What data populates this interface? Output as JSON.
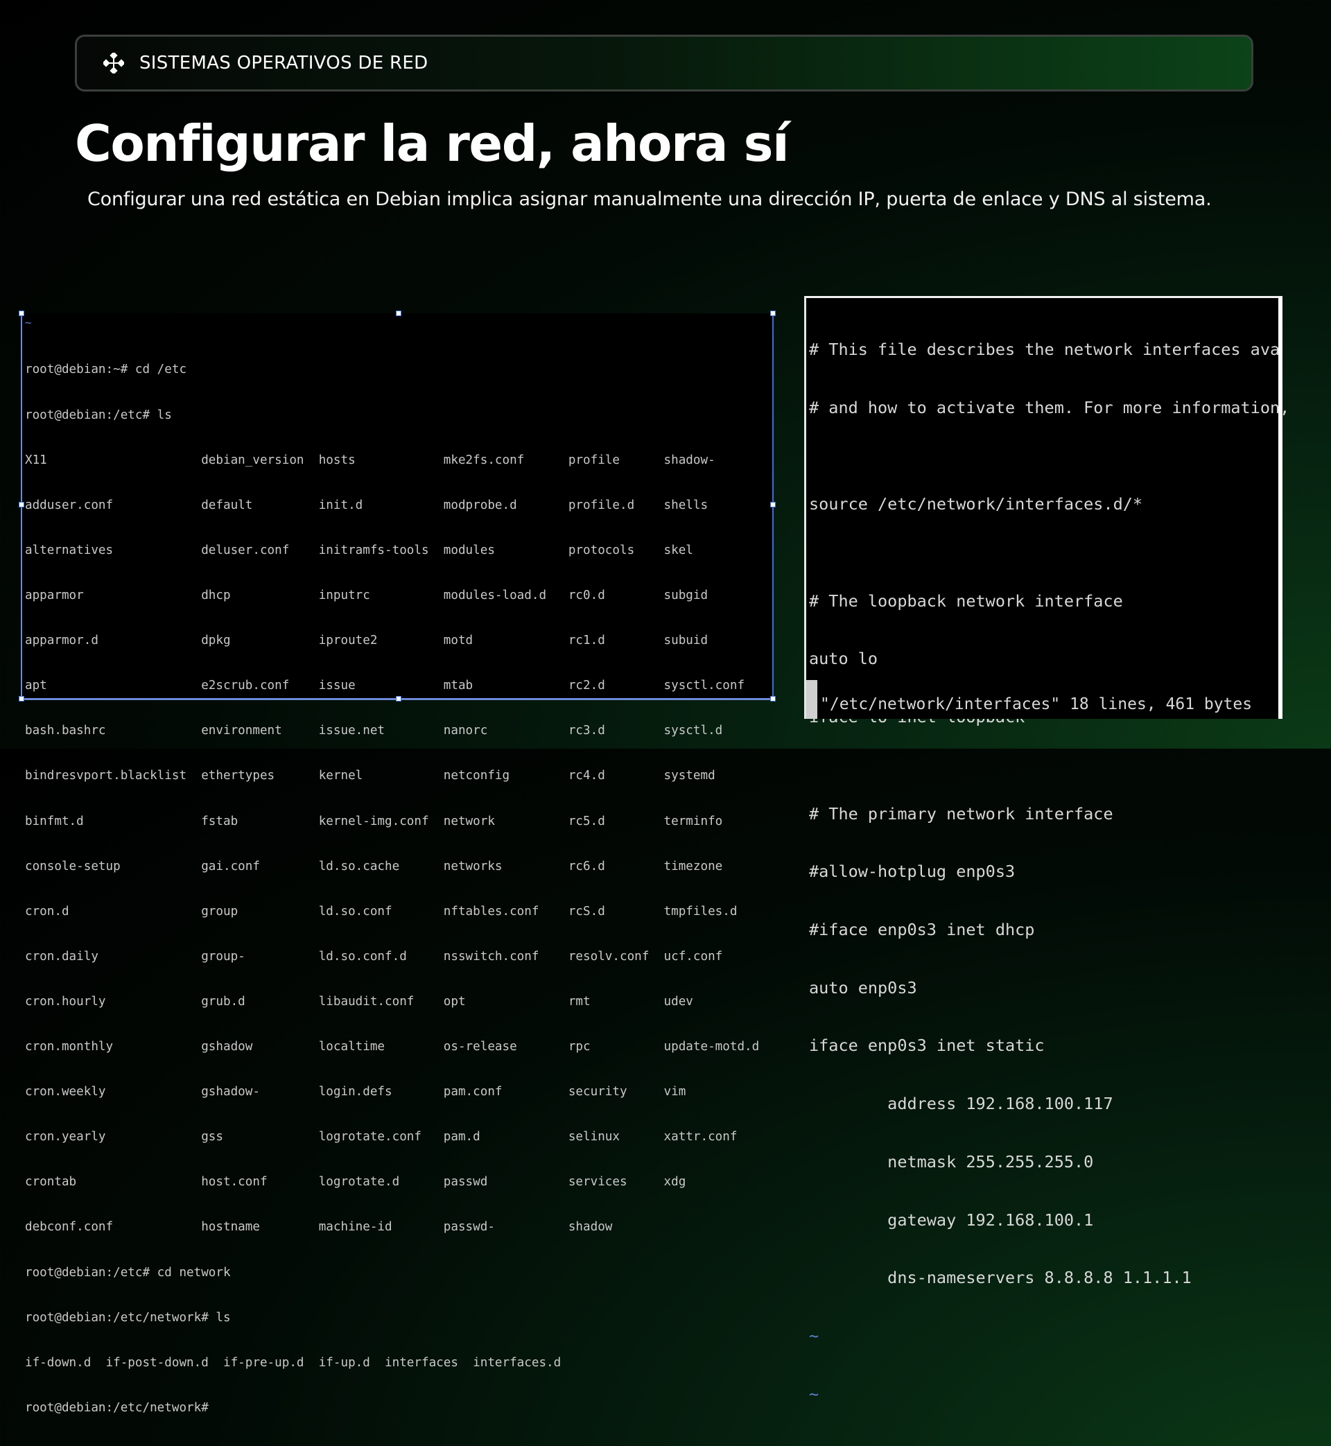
{
  "header": {
    "label": "SISTEMAS OPERATIVOS DE RED",
    "icon": "network-nodes-icon"
  },
  "title": "Configurar la red, ahora sí",
  "subtitle": "Configurar una red estática en Debian implica asignar manualmente una dirección IP, puerta de enlace y DNS al sistema.",
  "colors": {
    "background": "#000000",
    "accent_green": "#0c4318",
    "selection_blue": "#3b6fd6",
    "vim_tilde_blue": "#5f7fd8"
  },
  "terminal_left": {
    "tilde": "~",
    "lines": [
      "root@debian:~# cd /etc",
      "root@debian:/etc# ls",
      "X11                     debian_version  hosts            mke2fs.conf      profile      shadow-",
      "adduser.conf            default         init.d           modprobe.d       profile.d    shells",
      "alternatives            deluser.conf    initramfs-tools  modules          protocols    skel",
      "apparmor                dhcp            inputrc          modules-load.d   rc0.d        subgid",
      "apparmor.d              dpkg            iproute2         motd             rc1.d        subuid",
      "apt                     e2scrub.conf    issue            mtab             rc2.d        sysctl.conf",
      "bash.bashrc             environment     issue.net        nanorc           rc3.d        sysctl.d",
      "bindresvport.blacklist  ethertypes      kernel           netconfig        rc4.d        systemd",
      "binfmt.d                fstab           kernel-img.conf  network          rc5.d        terminfo",
      "console-setup           gai.conf        ld.so.cache      networks         rc6.d        timezone",
      "cron.d                  group           ld.so.conf       nftables.conf    rcS.d        tmpfiles.d",
      "cron.daily              group-          ld.so.conf.d     nsswitch.conf    resolv.conf  ucf.conf",
      "cron.hourly             grub.d          libaudit.conf    opt              rmt          udev",
      "cron.monthly            gshadow         localtime        os-release       rpc          update-motd.d",
      "cron.weekly             gshadow-        login.defs       pam.conf         security     vim",
      "cron.yearly             gss             logrotate.conf   pam.d            selinux      xattr.conf",
      "crontab                 host.conf       logrotate.d      passwd           services     xdg",
      "debconf.conf            hostname        machine-id       passwd-          shadow",
      "root@debian:/etc# cd network",
      "root@debian:/etc/network# ls",
      "if-down.d  if-post-down.d  if-pre-up.d  if-up.d  interfaces  interfaces.d",
      "root@debian:/etc/network#"
    ]
  },
  "terminal_right": {
    "file_lines": [
      "# This file describes the network interfaces ava",
      "# and how to activate them. For more information,",
      "",
      "source /etc/network/interfaces.d/*",
      "",
      "# The loopback network interface",
      "auto lo",
      "iface lo inet loopback",
      "",
      "# The primary network interface",
      "#allow-hotplug enp0s3",
      "#iface enp0s3 inet dhcp",
      "auto enp0s3",
      "iface enp0s3 inet static",
      "        address 192.168.100.117",
      "        netmask 255.255.255.0",
      "        gateway 192.168.100.1",
      "        dns-nameservers 8.8.8.8 1.1.1.1"
    ],
    "tilde_1": "~",
    "tilde_2": "~",
    "status": "\"/etc/network/interfaces\" 18 lines, 461 bytes"
  }
}
